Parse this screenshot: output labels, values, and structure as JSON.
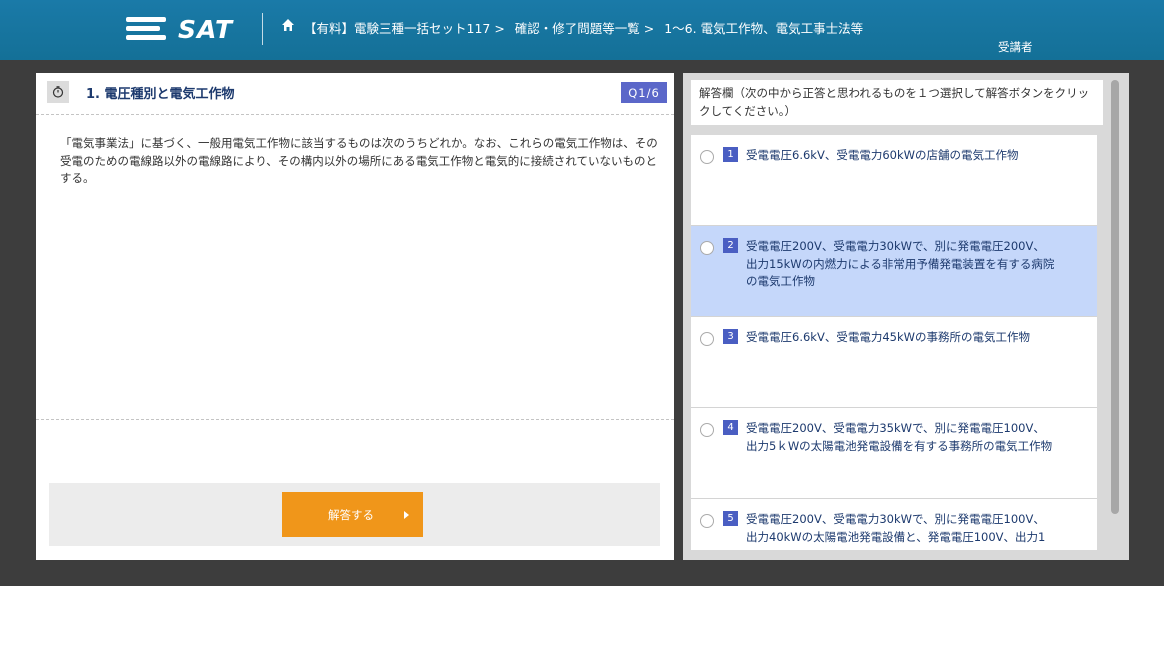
{
  "header": {
    "logo_text": "SAT",
    "breadcrumb": [
      "【有料】電験三種一括セット117 >",
      "確認・修了問題等一覧 >",
      "1〜6. 電気工作物、電気工事士法等"
    ],
    "user_label": "受講者"
  },
  "question": {
    "title": "1. 電圧種別と電気工作物",
    "counter": "Q1/6",
    "body": "「電気事業法」に基づく、一般用電気工作物に該当するものは次のうちどれか。なお、これらの電気工作物は、その受電のための電線路以外の電線路により、その構内以外の場所にある電気工作物と電気的に接続されていないものとする。",
    "answer_button": "解答する"
  },
  "answer_panel": {
    "instructions": "解答欄（次の中から正答と思われるものを１つ選択して解答ボタンをクリックしてください。）",
    "choices": [
      {
        "num": "1",
        "text": "受電電圧6.6kV、受電電力60kWの店舗の電気工作物"
      },
      {
        "num": "2",
        "text": "受電電圧200V、受電電力30kWで、別に発電電圧200V、出力15kWの内燃力による非常用予備発電装置を有する病院の電気工作物"
      },
      {
        "num": "3",
        "text": "受電電圧6.6kV、受電電力45kWの事務所の電気工作物"
      },
      {
        "num": "4",
        "text": "受電電圧200V、受電電力35kWで、別に発電電圧100V、出力5ｋWの太陽電池発電設備を有する事務所の電気工作物"
      },
      {
        "num": "5",
        "text": "受電電圧200V、受電電力30kWで、別に発電電圧100V、出力40kWの太陽電池発電設備と、発電電圧100V、出力1"
      }
    ],
    "selected_index": 1
  },
  "colors": {
    "header_bg": "#1a7aa8",
    "accent_orange": "#f0961a",
    "badge_blue": "#5b67c9",
    "selected_bg": "#c5d7fa",
    "stage_bg": "#3d3d3d"
  },
  "icons": [
    "hamburger-logo-icon",
    "home-icon",
    "clock-icon"
  ]
}
